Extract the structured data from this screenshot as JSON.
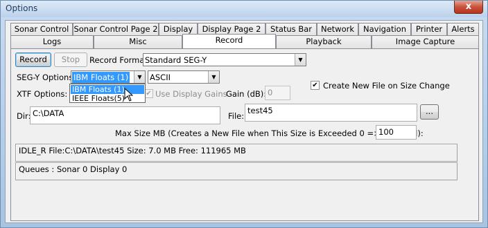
{
  "window": {
    "title": "Options",
    "close_label": "x"
  },
  "tabs_row1": [
    "Sonar Control",
    "Sonar Control Page 2",
    "Display",
    "Display Page 2",
    "Status Bar",
    "Network",
    "Navigation",
    "Printer",
    "Alerts"
  ],
  "tabs_row2": [
    "Logs",
    "Misc",
    "Record",
    "Playback",
    "Image Capture"
  ],
  "active_tab": "Record",
  "record": {
    "record_button": "Record",
    "stop_button": "Stop",
    "record_format_label": "Record Format",
    "record_format_value": "Standard SEG-Y",
    "segy_options_label": "SEG-Y Options",
    "segy_options_value": "IBM Floats (1)",
    "segy_options_list": [
      "IBM Floats (1)",
      "IEEE Floats(5)"
    ],
    "encoding_value": "ASCII",
    "create_new_file_label": "Create New File on Size Change",
    "create_new_file_checked": true,
    "xtf_options_label": "XTF Options:",
    "use_display_gains_label": "Use Display Gains",
    "use_display_gains_checked": true,
    "gain_label": "Gain (dB):",
    "gain_value": "0",
    "dir_label": "Dir:",
    "dir_value": "C:\\DATA",
    "file_label": "File:",
    "file_value": "test45",
    "browse_label": "...",
    "max_size_label": "Max Size MB (Creates a New File when This Size is Exceeded 0 => Disabled):",
    "max_size_value": "100",
    "status_line": "IDLE_R  File:C:\\DATA\\test45  Size:    7.0 MB  Free: 111965 MB",
    "queues_line": "Queues : Sonar 0 Display 0"
  },
  "icons": {
    "dropdown": "chevron-down-icon",
    "checkbox": "check-icon",
    "cursor": "mouse-pointer-icon"
  }
}
